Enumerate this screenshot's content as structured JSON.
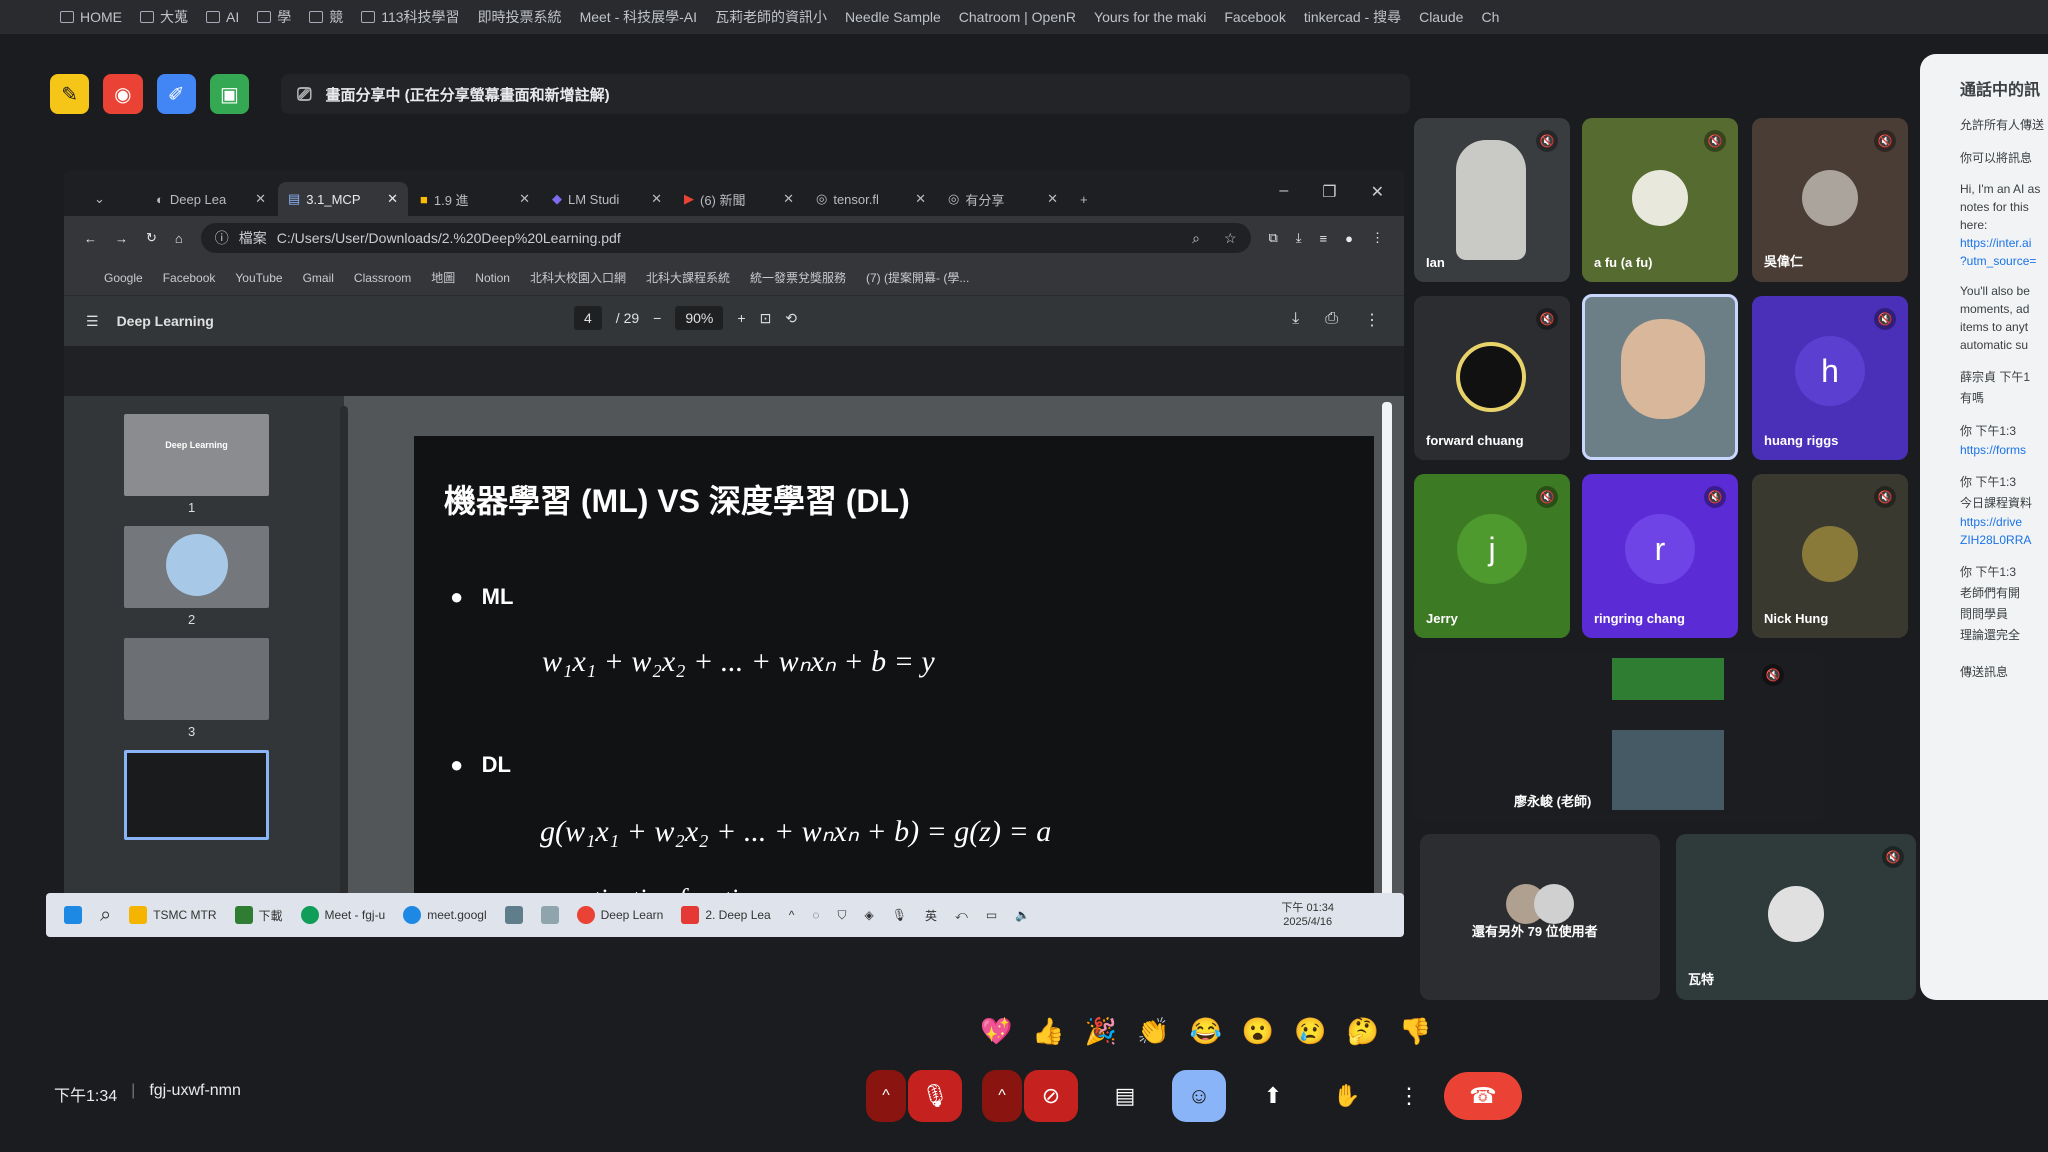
{
  "outer_bookmarks": [
    "HOME",
    "大蒐",
    "AI",
    "學",
    "競",
    "113科技學習",
    "即時投票系統",
    "Meet - 科技展學-AI",
    "瓦莉老師的資訊小",
    "Needle Sample",
    "Chatroom | OpenR",
    "Yours for the maki",
    "Facebook",
    "tinkercad - 搜尋",
    "Claude",
    "Ch"
  ],
  "meet": {
    "sharing_text": "畫面分享中 (正在分享螢幕畫面和新增註解)"
  },
  "browser": {
    "tabs": [
      "Deep Lea",
      "3.1_MCP",
      "1.9 進",
      "LM Studi",
      "(6) 新聞",
      "tensor.fl",
      "有分享"
    ],
    "active_tab_index": 1,
    "url": "C:/Users/User/Downloads/2.%20Deep%20Learning.pdf",
    "url_prefix": "檔案",
    "bookmarks": [
      "Google",
      "Facebook",
      "YouTube",
      "Gmail",
      "Classroom",
      "地圖",
      "Notion",
      "北科大校園入口網",
      "北科大課程系統",
      "統一發票兌獎服務",
      "(7) (提案開幕- (學..."
    ]
  },
  "pdf": {
    "title": "Deep Learning",
    "page_current": "4",
    "page_total": "/ 29",
    "zoom": "90%",
    "thumb_numbers": [
      "1",
      "2",
      "3"
    ],
    "thumb1_text": "Deep Learning"
  },
  "slide": {
    "title": "機器學習 (ML) VS 深度學習 (DL)",
    "bullet_ml": "ML",
    "bullet_dl": "DL",
    "formula_ml": "w₁x₁ + w₂x₂ + ... + wₙxₙ + b = y",
    "formula_dl": "g(w₁x₁ + w₂x₂ + ... + wₙxₙ + b) = g(z) = a",
    "note": "g: activation function"
  },
  "taskbar": {
    "items": [
      "TSMC MTR",
      "下載",
      "Meet - fgj-u",
      "meet.googl",
      "Deep Learn",
      "2. Deep Lea"
    ],
    "lang": "英",
    "time": "下午 01:34",
    "date": "2025/4/16"
  },
  "participants": [
    {
      "name": "Ian",
      "bg": "#3a3d40"
    },
    {
      "name": "a fu (a fu)",
      "bg": "#556b2f"
    },
    {
      "name": "吳偉仁",
      "bg": "#4a3d35"
    },
    {
      "name": "forward chuang",
      "bg": "#2c2d30"
    },
    {
      "name": "",
      "bg": "#6d7f86"
    },
    {
      "name": "huang riggs",
      "bg": "#4a2fb8",
      "letter": "h"
    },
    {
      "name": "Jerry",
      "bg": "#3d7a24",
      "letter": "j"
    },
    {
      "name": "ringring chang",
      "bg": "#5b2bd6",
      "letter": "r"
    },
    {
      "name": "Nick Hung",
      "bg": "#3a3930"
    },
    {
      "name": "廖永峻 (老師)",
      "bg": "#1c1d20"
    },
    {
      "name": "還有另外 79 位使用者",
      "bg": "#2c2d30"
    },
    {
      "name": "瓦特",
      "bg": "#2f3a3a"
    }
  ],
  "chat": {
    "header": "通話中的訊",
    "lines": [
      "允許所有人傳送",
      "你可以將訊息",
      "Hi, I'm an AI as",
      "notes for this",
      "here:",
      "https://inter.ai",
      "?utm_source=",
      "You'll also be",
      "moments, ad",
      "items to anyt",
      "automatic su",
      "薛宗貞 下午1",
      "有嗎",
      "你 下午1:3",
      "https://forms",
      "你 下午1:3",
      "今日課程資料",
      "https://drive",
      "ZIH28L0RRA",
      "你 下午1:3",
      "老師們有開",
      "問問學員",
      "理論還完全",
      "傳送訊息"
    ]
  },
  "reactions": [
    "💖",
    "👍",
    "🎉",
    "👏",
    "😂",
    "😮",
    "😢",
    "🤔",
    "👎"
  ],
  "bottom": {
    "time": "下午1:34",
    "meeting_code": "fgj-uxwf-nmn"
  },
  "icons": {
    "app_colors": [
      "#f5c518",
      "#ea4335",
      "#4285f4",
      "#34a853"
    ]
  }
}
